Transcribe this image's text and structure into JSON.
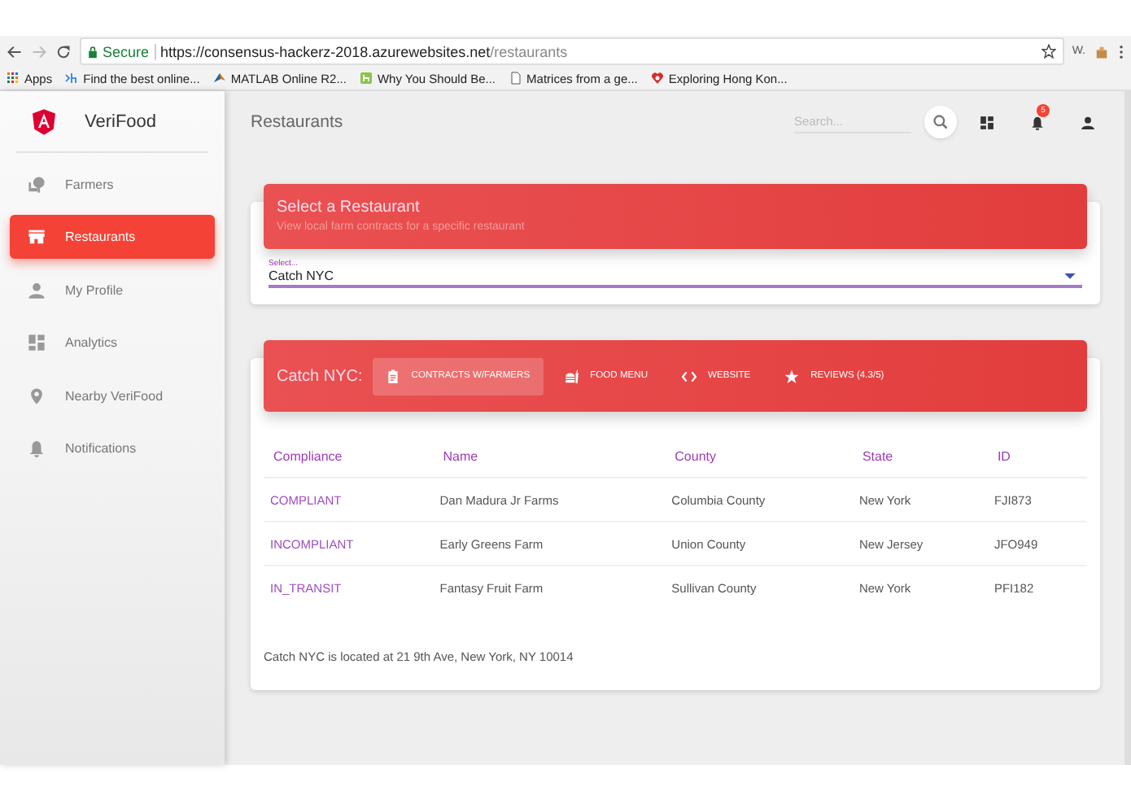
{
  "browser": {
    "security": "Secure",
    "url_host": "https://consensus-hackerz-2018.azurewebsites.net",
    "url_path": "/restaurants",
    "extension_label": "W.",
    "bookmarks": [
      {
        "label": "Apps",
        "kind": "apps"
      },
      {
        "label": "Find the best online...",
        "kind": "h-logo"
      },
      {
        "label": "MATLAB Online R2...",
        "kind": "cone"
      },
      {
        "label": "Why You Should Be...",
        "kind": "green-h"
      },
      {
        "label": "Matrices from a ge...",
        "kind": "page"
      },
      {
        "label": "Exploring Hong Kon...",
        "kind": "heart"
      }
    ]
  },
  "sidebar": {
    "brand": "VeriFood",
    "items": [
      {
        "label": "Farmers",
        "kind": "farmers",
        "selected": false
      },
      {
        "label": "Restaurants",
        "kind": "store",
        "selected": true
      },
      {
        "label": "My Profile",
        "kind": "person",
        "selected": false
      },
      {
        "label": "Analytics",
        "kind": "dashboard",
        "selected": false
      },
      {
        "label": "Nearby VeriFood",
        "kind": "pin",
        "selected": false
      },
      {
        "label": "Notifications",
        "kind": "bell",
        "selected": false
      }
    ]
  },
  "header": {
    "title": "Restaurants",
    "search": {
      "placeholder": "Search..."
    },
    "notification_count": "5"
  },
  "select_card": {
    "title": "Select a Restaurant",
    "subtitle": "View local farm contracts for a specific restaurant",
    "select": {
      "label": "Select...",
      "value": "Catch NYC"
    }
  },
  "details_card": {
    "title": "Catch NYC:",
    "tabs": [
      {
        "label": "CONTRACTS W/FARMERS",
        "kind": "clipboard",
        "selected": true
      },
      {
        "label": "FOOD MENU",
        "kind": "food",
        "selected": false
      },
      {
        "label": "WEBSITE",
        "kind": "code",
        "selected": false
      },
      {
        "label": "REVIEWS (4.3/5)",
        "kind": "star",
        "selected": false
      }
    ],
    "table": {
      "columns": [
        "Compliance",
        "Name",
        "County",
        "State",
        "ID"
      ],
      "rows": [
        [
          "COMPLIANT",
          "Dan Madura Jr Farms",
          "Columbia County",
          "New York",
          "FJI873"
        ],
        [
          "INCOMPLIANT",
          "Early Greens Farm",
          "Union County",
          "New Jersey",
          "JFO949"
        ],
        [
          "IN_TRANSIT",
          "Fantasy Fruit Farm",
          "Sullivan County",
          "New York",
          "PFI182"
        ]
      ]
    },
    "footer": "Catch NYC is located at 21 9th Ave, New York, NY 10014"
  }
}
